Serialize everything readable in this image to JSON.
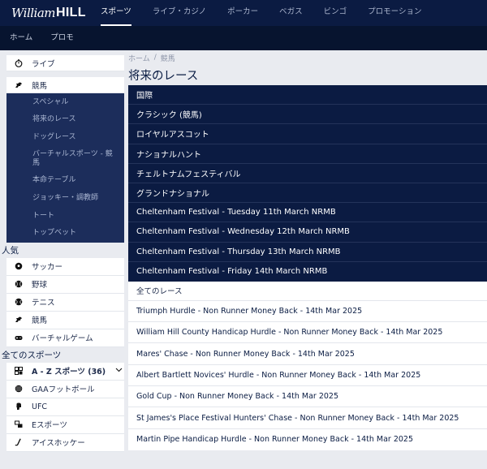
{
  "brand": {
    "script": "William",
    "bold": "HILL"
  },
  "main_nav": [
    "スポーツ",
    "ライブ・カジノ",
    "ポーカー",
    "ベガス",
    "ビンゴ",
    "プロモーション"
  ],
  "sub_nav": [
    "ホーム",
    "プロモ"
  ],
  "sidebar": {
    "live": "ライブ",
    "horse_racing": "競馬",
    "racing_sub": [
      "スペシャル",
      "将来のレース",
      "ドッグレース",
      "バーチャルスポーツ - 競馬",
      "本命テーブル",
      "ジョッキー・調教師",
      "トート",
      "トップベット"
    ],
    "popular_heading": "人気",
    "popular": [
      {
        "label": "サッカー",
        "icon": "soccer-ball-icon"
      },
      {
        "label": "野球",
        "icon": "baseball-icon"
      },
      {
        "label": "テニス",
        "icon": "tennis-ball-icon"
      },
      {
        "label": "競馬",
        "icon": "horse-icon"
      },
      {
        "label": "バーチャルゲーム",
        "icon": "controller-icon"
      }
    ],
    "all_sports_heading": "全てのスポーツ",
    "all_sports": {
      "az_label": "A - Z スポーツ (36)",
      "items": [
        "GAAフットボール",
        "UFC",
        "Eスポーツ",
        "アイスホッケー"
      ]
    }
  },
  "breadcrumb": {
    "home": "ホーム",
    "separator": "/",
    "current": "競馬"
  },
  "page_title": "将来のレース",
  "categories": [
    "国際",
    "クラシック (競馬)",
    "ロイヤルアスコット",
    "ナショナルハント",
    "チェルトナムフェスティバル",
    "グランドナショナル",
    "Cheltenham Festival - Tuesday 11th March NRMB",
    "Cheltenham Festival - Wednesday 12th March NRMB",
    "Cheltenham Festival - Thursday 13th March NRMB",
    "Cheltenham Festival - Friday 14th March NRMB"
  ],
  "all_races": {
    "heading": "全てのレース",
    "items": [
      "Triumph Hurdle - Non Runner Money Back - 14th Mar 2025",
      "William Hill County Handicap Hurdle - Non Runner Money Back - 14th Mar 2025",
      "Mares' Chase - Non Runner Money Back - 14th Mar 2025",
      "Albert Bartlett Novices' Hurdle - Non Runner Money Back - 14th Mar 2025",
      "Gold Cup - Non Runner Money Back - 14th Mar 2025",
      "St James's Place Festival Hunters' Chase - Non Runner Money Back - 14th Mar 2025",
      "Martin Pipe Handicap Hurdle - Non Runner Money Back - 14th Mar 2025"
    ]
  },
  "colors": {
    "navy": "#0b1b42",
    "sidebar_sub": "#1c2d5b",
    "background": "#e9ebf0"
  }
}
